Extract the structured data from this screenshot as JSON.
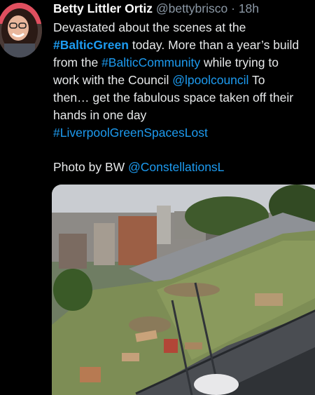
{
  "tweet": {
    "author_name": "Betty Littler Ortiz",
    "author_handle": "@bettybrisco",
    "separator": "·",
    "timestamp": "18h",
    "lines": [
      [
        "Devastated about the scenes at the"
      ],
      [
        "#BalticGreen",
        " today. More than a year’s build"
      ],
      [
        "from the ",
        "#BalticCommunity",
        " while trying to"
      ],
      [
        "work with the Council ",
        "@lpoolcouncil",
        " To"
      ],
      [
        "then… get the fabulous space taken off their"
      ],
      [
        "hands in one day"
      ],
      [
        "#LiverpoolGreenSpacesLost"
      ]
    ],
    "photo_credit_text": "Photo by BW ",
    "photo_credit_mention": "@ConstellationsL"
  },
  "colors": {
    "background": "#000000",
    "text": "#e7e9ea",
    "link": "#1d9bf0",
    "muted": "#8b98a5"
  },
  "media": {
    "icon": "photo"
  }
}
